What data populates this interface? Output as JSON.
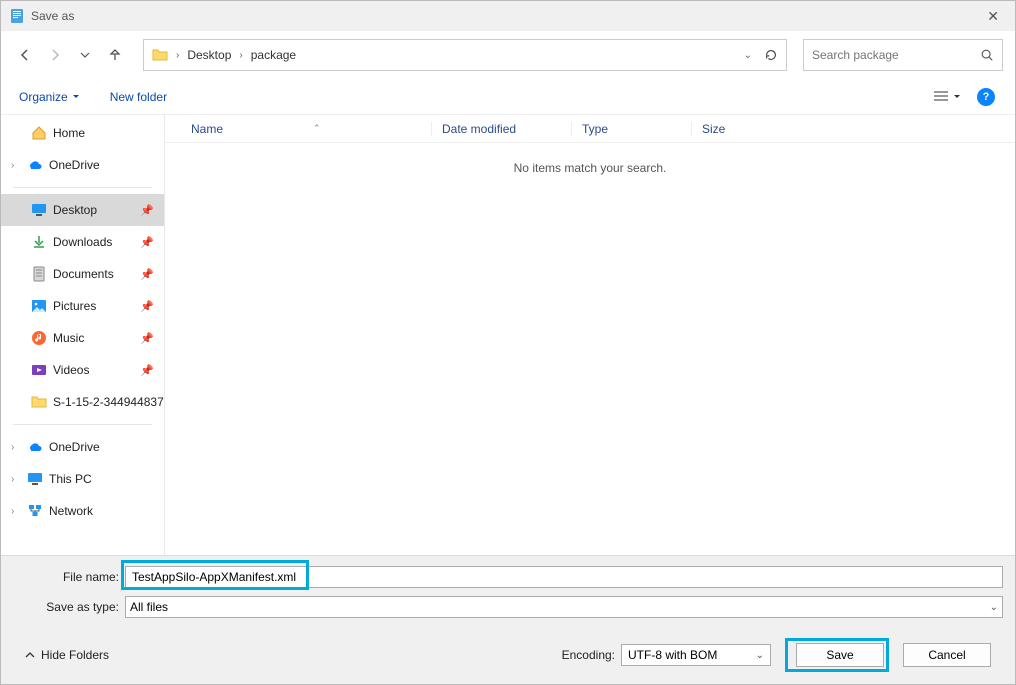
{
  "window": {
    "title": "Save as"
  },
  "breadcrumb": {
    "root": "Desktop",
    "sub": "package"
  },
  "search": {
    "placeholder": "Search package"
  },
  "toolbar": {
    "organize": "Organize",
    "newfolder": "New folder"
  },
  "sidebar": {
    "home": "Home",
    "onedrive": "OneDrive",
    "desktop": "Desktop",
    "downloads": "Downloads",
    "documents": "Documents",
    "pictures": "Pictures",
    "music": "Music",
    "videos": "Videos",
    "sidfolder": "S-1-15-2-344944837",
    "onedrive2": "OneDrive",
    "thispc": "This PC",
    "network": "Network"
  },
  "columns": {
    "name": "Name",
    "date": "Date modified",
    "type": "Type",
    "size": "Size"
  },
  "list": {
    "empty": "No items match your search."
  },
  "fields": {
    "filename_label": "File name:",
    "filename_value": "TestAppSilo-AppXManifest.xml",
    "type_label": "Save as type:",
    "type_value": "All files"
  },
  "footer": {
    "hide": "Hide Folders",
    "encoding_label": "Encoding:",
    "encoding_value": "UTF-8 with BOM",
    "save": "Save",
    "cancel": "Cancel"
  }
}
